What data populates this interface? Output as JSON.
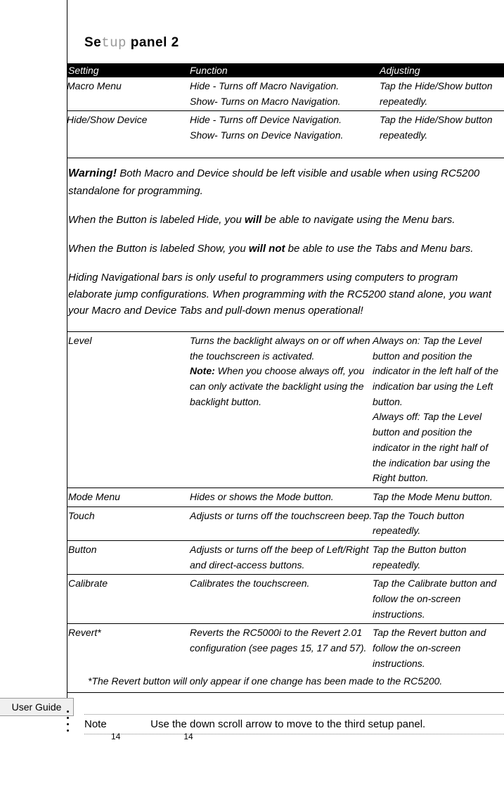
{
  "title": {
    "se": "Se",
    "tup": "tup",
    "panel": " panel 2"
  },
  "headers": {
    "setting": "Setting",
    "function": "Function",
    "adjusting": "Adjusting"
  },
  "row_macro": {
    "setting": "Macro Menu",
    "func1": "Hide - Turns off Macro Navigation.",
    "func2": "Show- Turns on Macro Navigation.",
    "adj1": "Tap the Hide/Show button",
    "adj2": "repeatedly."
  },
  "row_device": {
    "setting": "Hide/Show Device",
    "func1": "Hide - Turns off Device Navigation.",
    "func2": "Show- Turns on Device Navigation.",
    "adj1": "Tap the Hide/Show button",
    "adj2": "repeatedly."
  },
  "warning": {
    "label": "Warning!",
    "p1": " Both Macro and Device should be left visible and usable when using RC5200 standalone for programming.",
    "p2a": "When the Button is labeled Hide, you ",
    "p2b": "will",
    "p2c": " be able to navigate using the Menu bars.",
    "p3a": "When the Button is labeled Show, you ",
    "p3b": "will not",
    "p3c": " be able to use the Tabs and Menu bars.",
    "p4": "Hiding Navigational bars is only useful to programmers using computers to program elaborate jump configurations. When programming with the RC5200 stand alone, you want your Macro and Device Tabs and pull-down menus operational!"
  },
  "row_level": {
    "setting": "Level",
    "func_a": "Turns the backlight always on or off when the touchscreen is activated.",
    "func_note_label": "Note:",
    "func_b": " When you choose always off, you can only activate the backlight using the backlight button.",
    "adj": "Always on: Tap the Level button and position the indicator in the left half of the indication bar using the Left button.\nAlways off: Tap the Level button and position the indicator in the right half of the indication bar using the Right button."
  },
  "row_mode": {
    "setting": "Mode Menu",
    "func": "Hides or shows the Mode button.",
    "adj": "Tap the Mode Menu button."
  },
  "row_touch": {
    "setting": "Touch",
    "func": "Adjusts or turns off the touchscreen beep.",
    "adj": "Tap the Touch button  repeatedly."
  },
  "row_button": {
    "setting": "Button",
    "func": "Adjusts or turns off the beep of Left/Right and direct-access buttons.",
    "adj": "Tap the Button button repeatedly."
  },
  "row_calibrate": {
    "setting": "Calibrate",
    "func": "Calibrates the touchscreen.",
    "adj": "Tap the Calibrate button and follow the on-screen instructions."
  },
  "row_revert": {
    "setting": "Revert*",
    "func": "Reverts the RC5000i to the Revert 2.01 configuration (see pages 15, 17 and 57).",
    "adj": "Tap the Revert button and follow the on-screen instructions."
  },
  "revert_note": "*The Revert button will only appear if one change has been made to the RC5200.",
  "note": {
    "label": "Note",
    "text": "Use the down scroll arrow  to move to the third setup panel."
  },
  "user_guide": "User Guide",
  "page_num_1": "14",
  "page_num_2": "14"
}
